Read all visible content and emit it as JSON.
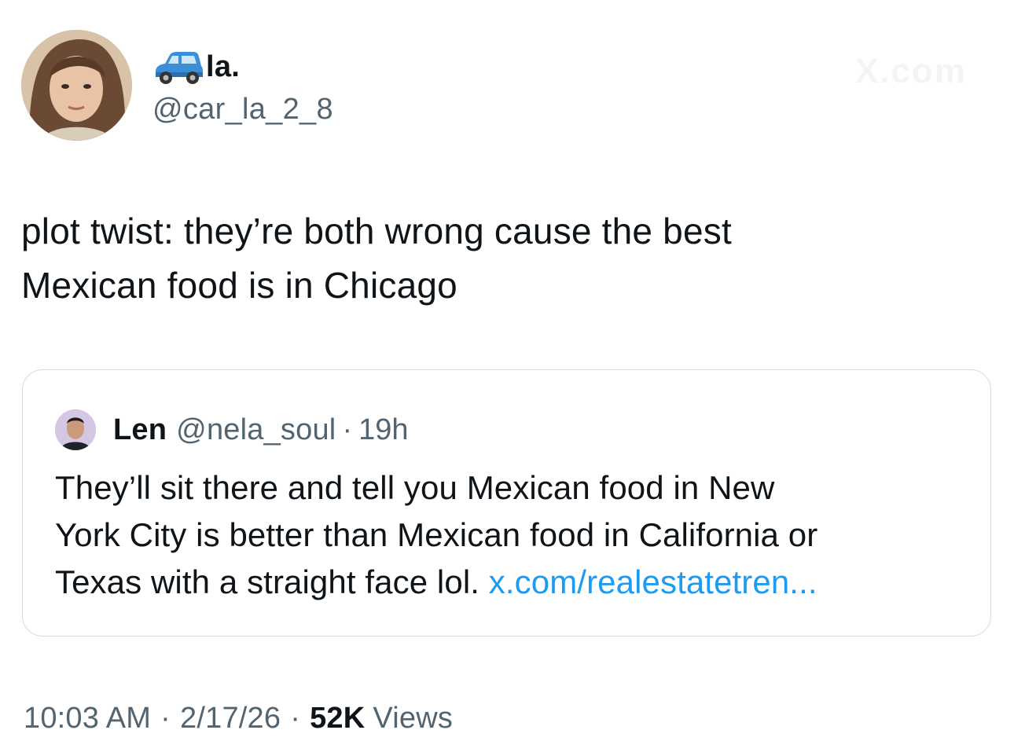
{
  "author": {
    "avatar_icon": "profile-photo",
    "name_icon": "car-emoji-icon",
    "display_name": "la.",
    "handle": "@car_la_2_8"
  },
  "watermark": "X.com",
  "tweet": {
    "text": "plot twist: they’re both wrong cause the best\nMexican food is in Chicago"
  },
  "quoted_tweet": {
    "avatar_icon": "profile-photo",
    "name": "Len",
    "handle": "@nela_soul",
    "separator": "·",
    "time": "19h",
    "text": "They’ll sit there and tell you Mexican food in New\nYork City is better than Mexican food in California or\nTexas with a straight face lol. ",
    "link": "x.com/realestatetren..."
  },
  "meta": {
    "time": "10:03 AM",
    "separator": "·",
    "date": "2/17/26",
    "views_count": "52K",
    "views_label": "Views"
  },
  "colors": {
    "text_primary": "#0f1419",
    "text_secondary": "#536471",
    "link": "#1d9bf0",
    "border": "#d6dcdf"
  }
}
